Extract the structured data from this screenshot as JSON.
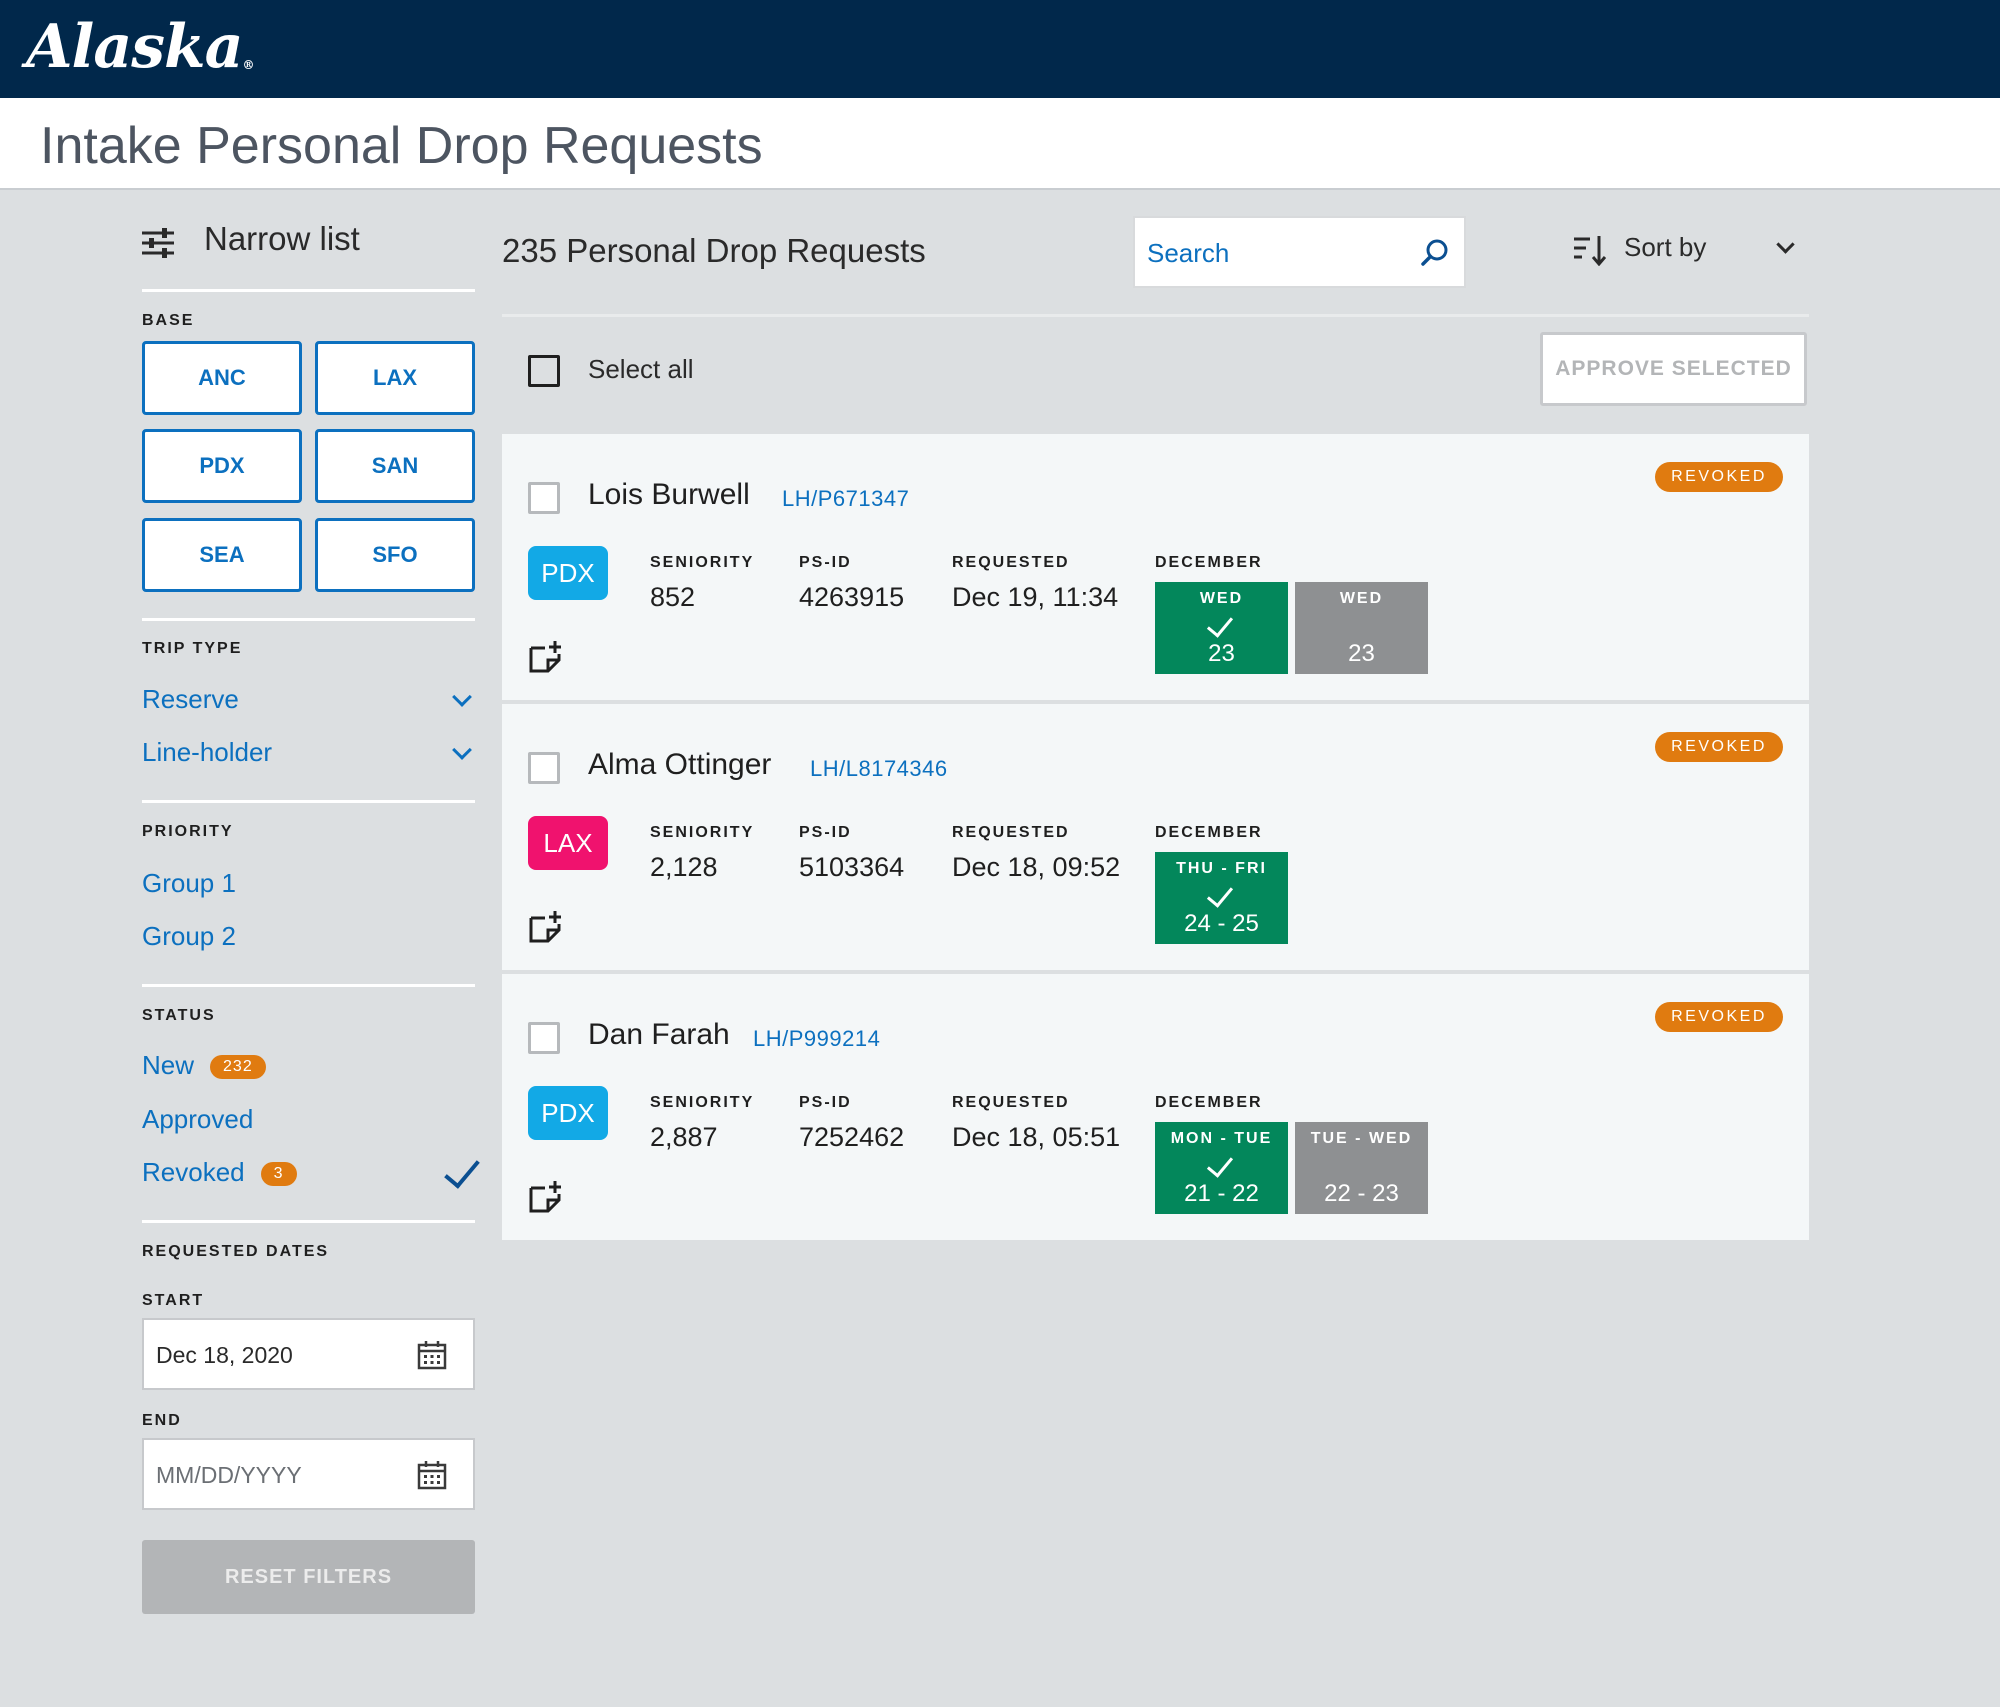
{
  "brand": {
    "logo_text": "Alaska",
    "logo_mark": "®"
  },
  "page": {
    "title": "Intake Personal Drop Requests"
  },
  "sidebar": {
    "narrow_label": "Narrow list",
    "base": {
      "label": "BASE",
      "options": [
        "ANC",
        "LAX",
        "PDX",
        "SAN",
        "SEA",
        "SFO"
      ]
    },
    "trip_type": {
      "label": "TRIP TYPE",
      "options": [
        "Reserve",
        "Line-holder"
      ]
    },
    "priority": {
      "label": "PRIORITY",
      "options": [
        "Group 1",
        "Group 2"
      ]
    },
    "status": {
      "label": "STATUS",
      "options": [
        {
          "label": "New",
          "count": "232",
          "selected": false
        },
        {
          "label": "Approved",
          "count": "",
          "selected": false
        },
        {
          "label": "Revoked",
          "count": "3",
          "selected": true
        }
      ]
    },
    "requested_dates": {
      "label": "REQUESTED DATES",
      "start_label": "START",
      "start_value": "Dec 18, 2020",
      "end_label": "END",
      "end_placeholder": "MM/DD/YYYY"
    },
    "reset_label": "RESET FILTERS"
  },
  "main": {
    "count_title": "235 Personal Drop Requests",
    "search_placeholder": "Search",
    "sort_label": "Sort by",
    "select_all_label": "Select all",
    "approve_label": "APPROVE SELECTED",
    "meta_labels": {
      "seniority": "SENIORITY",
      "psid": "PS-ID",
      "requested": "REQUESTED"
    },
    "requests": [
      {
        "name": "Lois Burwell",
        "line_id": "LH/P671347",
        "status": "REVOKED",
        "base": "PDX",
        "base_color": "#12a9e6",
        "seniority": "852",
        "psid": "4263915",
        "requested": "Dec 19, 11:34",
        "month": "DECEMBER",
        "days": [
          {
            "day": "WED",
            "date": "23",
            "approved": true
          },
          {
            "day": "WED",
            "date": "23",
            "approved": false
          }
        ]
      },
      {
        "name": "Alma Ottinger",
        "line_id": "LH/L8174346",
        "status": "REVOKED",
        "base": "LAX",
        "base_color": "#f0126e",
        "seniority": "2,128",
        "psid": "5103364",
        "requested": "Dec 18, 09:52",
        "month": "DECEMBER",
        "days": [
          {
            "day": "THU - FRI",
            "date": "24 - 25",
            "approved": true
          }
        ]
      },
      {
        "name": "Dan Farah",
        "line_id": "LH/P999214",
        "status": "REVOKED",
        "base": "PDX",
        "base_color": "#12a9e6",
        "seniority": "2,887",
        "psid": "7252462",
        "requested": "Dec 18, 05:51",
        "month": "DECEMBER",
        "days": [
          {
            "day": "MON - TUE",
            "date": "21 - 22",
            "approved": true
          },
          {
            "day": "TUE - WED",
            "date": "22 - 23",
            "approved": false
          }
        ]
      }
    ]
  },
  "colors": {
    "header_bg": "#01284b",
    "accent": "#0c70bf",
    "approved_tile": "#03875b",
    "pending_tile": "#8e9092",
    "revoked_pill": "#e07b10"
  }
}
